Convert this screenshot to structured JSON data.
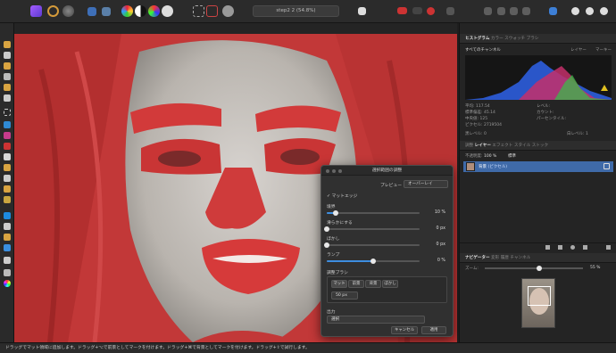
{
  "doc": {
    "title": "step2 2 (54.8%)"
  },
  "dialog": {
    "title": "選択範囲の調整",
    "preview_label": "プレビュー",
    "preview_value": "オーバーレイ",
    "matte_edges": "マットエッジ",
    "border_label": "境界",
    "border_value": "10 %",
    "border_fraction": 0.1,
    "smooth_label": "滑らかにする",
    "smooth_value": "0 px",
    "smooth_fraction": 0.0,
    "feather_label": "ぼかし",
    "feather_value": "0 px",
    "feather_fraction": 0.0,
    "ramp_label": "ランプ",
    "ramp_value": "0 %",
    "ramp_fraction": 0.5,
    "brush_label": "調整ブラシ",
    "brush_modes": [
      "マット",
      "前景",
      "背景",
      "ぼかし"
    ],
    "brush_size": "50 px",
    "output_label": "出力",
    "output_value": "選択",
    "cancel": "キャンセル",
    "apply": "適用"
  },
  "histogram": {
    "tabs": [
      "ヒストグラム",
      "カラー",
      "スウォッチ",
      "ブラシ"
    ],
    "channel": "すべてのチャンネル",
    "layer_btn": "レイヤー",
    "marker_btn": "マーキー",
    "stats": {
      "mean_label": "平均:",
      "mean": "117.54",
      "std_label": "標準偏差:",
      "std": "45.14",
      "median_label": "中央値:",
      "median": "125",
      "pixels_label": "ピクセル:",
      "pixels": "2719504"
    },
    "stats_right": [
      "レベル:",
      "カウント:",
      "パーセンタイル:"
    ],
    "black_label": "黒レベル:",
    "black": "0",
    "white_label": "白レベル:",
    "white": "1"
  },
  "layers": {
    "tabs": [
      "調整",
      "レイヤー",
      "エフェクト",
      "スタイル",
      "ストック"
    ],
    "opacity_label": "不透明度:",
    "opacity": "100 %",
    "blend": "標準",
    "layer_name": "背景",
    "layer_type": "(ピクセル)"
  },
  "navigator": {
    "tabs": [
      "ナビゲーター",
      "変形",
      "履歴",
      "チャンネル"
    ],
    "zoom_label": "ズーム:",
    "zoom": "55 %",
    "zoom_fraction": 0.55
  },
  "status": {
    "text": "ドラッグでマット領域に追加します。ドラッグ+⌥で前景としてマークを付けます。ドラッグ+⌘で背景としてマークを付けます。ドラッグ+⇧で試行します。"
  }
}
